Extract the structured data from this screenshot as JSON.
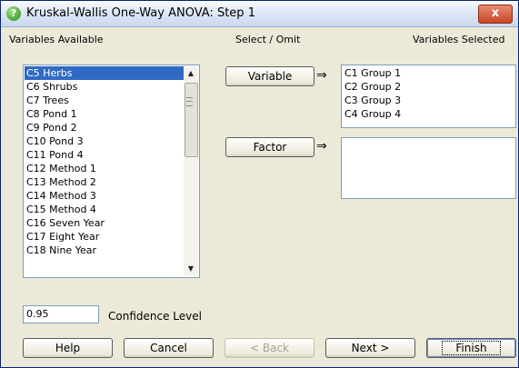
{
  "window": {
    "title": "Kruskal-Wallis One-Way ANOVA: Step 1",
    "close_symbol": "x"
  },
  "labels": {
    "variables_available": "Variables Available",
    "select_omit": "Select / Omit",
    "variables_selected": "Variables Selected",
    "confidence_level": "Confidence Level"
  },
  "available_list": {
    "items": [
      "C5 Herbs",
      "C6 Shrubs",
      "C7 Trees",
      "C8 Pond 1",
      "C9 Pond 2",
      "C10 Pond 3",
      "C11 Pond 4",
      "C12 Method 1",
      "C13 Method 2",
      "C14 Method 3",
      "C15 Method 4",
      "C16 Seven Year",
      "C17 Eight Year",
      "C18 Nine Year"
    ],
    "selected_index": 0
  },
  "selected_list": {
    "items": [
      "C1 Group 1",
      "C2 Group 2",
      "C3 Group 3",
      "C4 Group 4"
    ]
  },
  "factor_list": {
    "items": []
  },
  "buttons": {
    "variable": "Variable",
    "factor": "Factor",
    "help": "Help",
    "cancel": "Cancel",
    "back": "< Back",
    "next": "Next >",
    "finish": "Finish"
  },
  "arrows": {
    "symbol": "⇒"
  },
  "confidence_input": {
    "value": "0.95"
  }
}
